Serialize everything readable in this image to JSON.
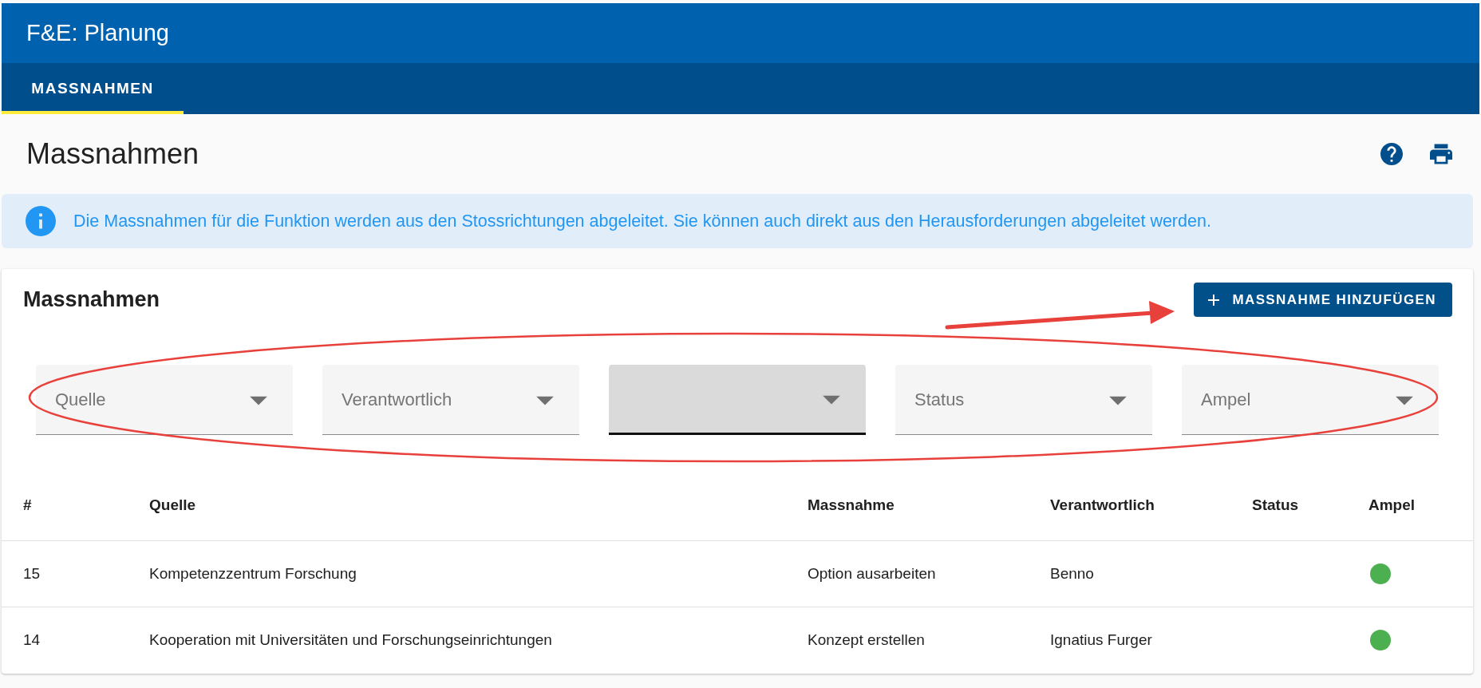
{
  "app": {
    "title": "F&E: Planung"
  },
  "tabs": [
    {
      "label": "MASSNAHMEN",
      "selected": true
    }
  ],
  "page": {
    "title": "Massnahmen"
  },
  "info": {
    "text": "Die Massnahmen für die Funktion werden aus den Stossrichtungen abgeleitet. Sie können auch direkt aus den Herausforderungen abgeleitet werden."
  },
  "card": {
    "title": "Massnahmen",
    "add_button": "MASSNAHME HINZUFÜGEN"
  },
  "filters": [
    {
      "label": "Quelle",
      "focused": false
    },
    {
      "label": "Verantwortlich",
      "focused": false
    },
    {
      "focused": true
    },
    {
      "label": "Status",
      "focused": false
    },
    {
      "label": "Ampel",
      "focused": false
    }
  ],
  "table": {
    "columns": [
      "#",
      "Quelle",
      "Massnahme",
      "Verantwortlich",
      "Status",
      "Ampel"
    ],
    "rows": [
      {
        "number": "15",
        "quelle": "Kompetenzzentrum Forschung",
        "massnahme": "Option ausarbeiten",
        "verantwortlich": "Benno",
        "color": "#4caf50"
      },
      {
        "number": "14",
        "quelle": "Kooperation mit Universitäten und Forschungseinrichtungen",
        "massnahme": "Konzept erstellen",
        "verantwortlich": "Ignatius Furger",
        "color": "#4caf50"
      }
    ]
  }
}
